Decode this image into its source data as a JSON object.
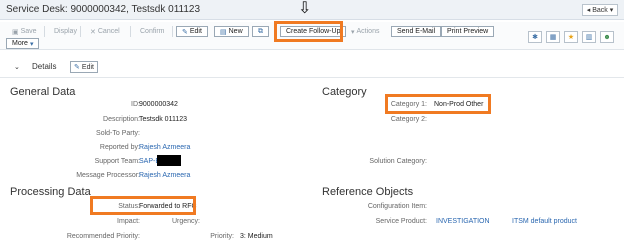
{
  "window": {
    "title": "Service Desk: 9000000342, Testsdk 011123",
    "back_label": "Back"
  },
  "toolbar": {
    "save": "Save",
    "display": "Display",
    "cancel": "Cancel",
    "confirm": "Confirm",
    "edit": "Edit",
    "new": "New",
    "create_follow_up": "Create Follow-Up",
    "actions": "Actions",
    "send_email": "Send E-Mail",
    "print_preview": "Print Preview",
    "more": "More"
  },
  "details": {
    "title": "Details",
    "edit": "Edit"
  },
  "general": {
    "title": "General Data",
    "id_label": "ID:",
    "id_value": "9000000342",
    "description_label": "Description:",
    "description_value": "Testsdk 011123",
    "sold_to_label": "Sold-To Party:",
    "reported_by_label": "Reported by:",
    "reported_by_value": "Rajesh Azmeera",
    "support_team_label": "Support Team:",
    "support_team_value": "SAP-Basis",
    "message_processor_label": "Message Processor:",
    "message_processor_value": "Rajesh Azmeera"
  },
  "category": {
    "title": "Category",
    "cat1_label": "Category 1:",
    "cat1_value": "Non-Prod Other",
    "cat2_label": "Category 2:",
    "solution_label": "Solution Category:"
  },
  "processing": {
    "title": "Processing Data",
    "status_label": "Status:",
    "status_value": "Forwarded to RFC",
    "impact_label": "Impact:",
    "urgency_label": "Urgency:",
    "recommended_priority_label": "Recommended Priority:",
    "priority_label": "Priority:",
    "priority_value": "3: Medium"
  },
  "reference": {
    "title": "Reference Objects",
    "config_item_label": "Configuration Item:",
    "service_product_label": "Service Product:",
    "service_product_value": "INVESTIGATION",
    "service_product_desc": "ITSM default product"
  },
  "colors": {
    "highlight": "#f07a22",
    "link": "#2a67b0"
  }
}
